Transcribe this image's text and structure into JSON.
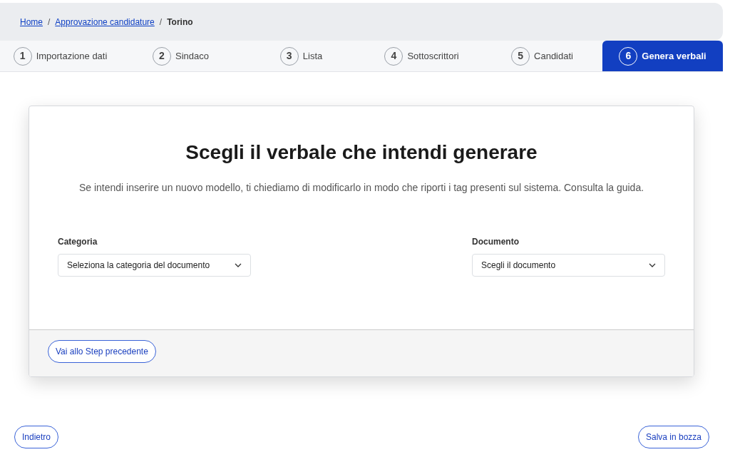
{
  "breadcrumb_separator": "/",
  "breadcrumb": [
    {
      "label": "Home",
      "current": false
    },
    {
      "label": "Approvazione candidature",
      "current": false
    },
    {
      "label": "Torino",
      "current": true
    }
  ],
  "steps": [
    {
      "number": "1",
      "label": "Importazione dati",
      "selected": false
    },
    {
      "number": "2",
      "label": "Sindaco",
      "selected": false
    },
    {
      "number": "3",
      "label": "Lista",
      "selected": false
    },
    {
      "number": "4",
      "label": "Sottoscrittori",
      "selected": false
    },
    {
      "number": "5",
      "label": "Candidati",
      "selected": false
    },
    {
      "number": "6",
      "label": "Genera verbali",
      "selected": true
    }
  ],
  "card": {
    "title": "Scegli il verbale che intendi generare",
    "description": "Se intendi inserire un nuovo modello, ti chiediamo di modificarlo in modo che riporti i tag presenti sul sistema. Consulta la guida.",
    "fields": [
      {
        "label": "Categoria",
        "value": "Seleziona la categoria del documento"
      },
      {
        "label": "Documento",
        "value": "Scegli il documento"
      }
    ],
    "footer_button": "Vai allo Step precedente"
  },
  "buttons": {
    "back": "Indietro",
    "save": "Salva in bozza"
  }
}
